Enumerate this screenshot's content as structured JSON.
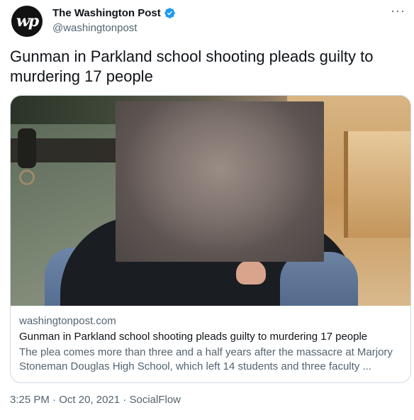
{
  "account": {
    "avatar_glyph": "wp",
    "display_name": "The Washington Post",
    "handle": "@washingtonpost",
    "verified": true
  },
  "more_label": "···",
  "tweet_text": "Gunman in Parkland school shooting pleads guilty to murdering 17 people",
  "card": {
    "domain": "washingtonpost.com",
    "title": "Gunman in Parkland school shooting pleads guilty to murdering 17 people",
    "description": "The plea comes more than three and a half years after the massacre at Marjory Stoneman Douglas High School, which left 14 students and three faculty ..."
  },
  "meta": {
    "time": "3:25 PM",
    "separator": " · ",
    "date": "Oct 20, 2021",
    "source": "SocialFlow"
  },
  "colors": {
    "verified_badge": "#1d9bf0",
    "secondary_text": "#536471",
    "border": "#cfd9de"
  }
}
